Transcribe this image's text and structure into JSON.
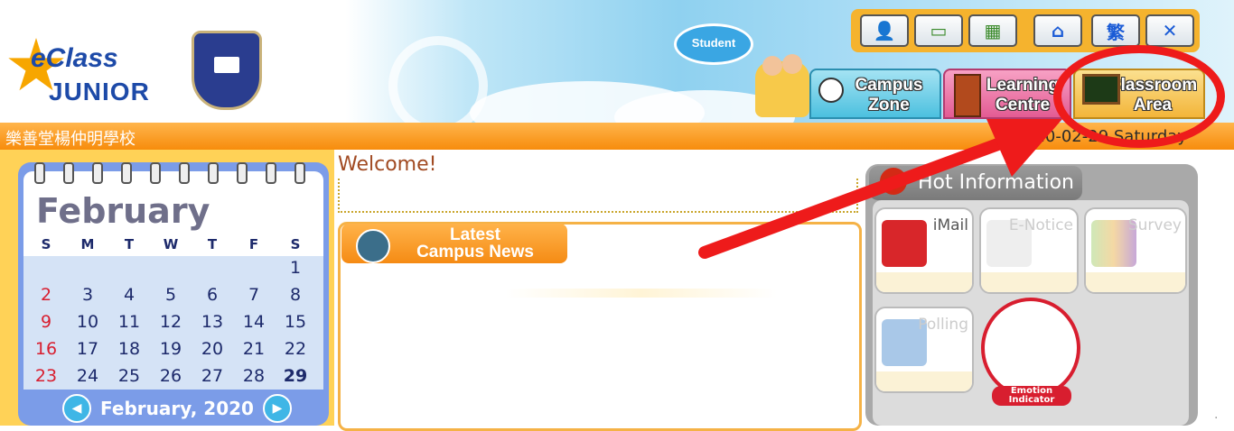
{
  "header": {
    "logo_top": "eClass",
    "logo_bottom": "JUNIOR",
    "badge": "Student"
  },
  "toolbar": {
    "buttons": [
      {
        "name": "user-settings",
        "icon": "person-check-icon",
        "glyph": "👤"
      },
      {
        "name": "profile-card",
        "icon": "id-card-icon",
        "glyph": "▭"
      },
      {
        "name": "calendar",
        "icon": "calendar-icon",
        "glyph": "▦"
      },
      {
        "name": "home",
        "icon": "home-icon",
        "glyph": "⌂"
      },
      {
        "name": "language",
        "icon": "language-icon",
        "glyph": "繁"
      },
      {
        "name": "close",
        "icon": "close-icon",
        "glyph": "✕"
      }
    ]
  },
  "nav": {
    "campus": {
      "line1": "Campus",
      "line2": "Zone"
    },
    "learning": {
      "line1": "Learning",
      "line2": "Centre"
    },
    "classroom": {
      "line1": "Classroom",
      "line2": "Area"
    }
  },
  "bar": {
    "school": "樂善堂楊仲明學校",
    "date": "2020-02-29 Saturday"
  },
  "calendar": {
    "month": "February",
    "weekdays": [
      "S",
      "M",
      "T",
      "W",
      "T",
      "F",
      "S"
    ],
    "weeks": [
      [
        "",
        "",
        "",
        "",
        "",
        "",
        "1"
      ],
      [
        "2",
        "3",
        "4",
        "5",
        "6",
        "7",
        "8"
      ],
      [
        "9",
        "10",
        "11",
        "12",
        "13",
        "14",
        "15"
      ],
      [
        "16",
        "17",
        "18",
        "19",
        "20",
        "21",
        "22"
      ],
      [
        "23",
        "24",
        "25",
        "26",
        "27",
        "28",
        "29"
      ]
    ],
    "today": "29",
    "nav_label": "February, 2020"
  },
  "main": {
    "welcome": "Welcome!",
    "news_title_1": "Latest",
    "news_title_2": "Campus News"
  },
  "hot": {
    "title": "Hot Information",
    "items": [
      {
        "label": "iMail",
        "active": true,
        "icon": "mailbox-icon"
      },
      {
        "label": "E-Notice",
        "active": false,
        "icon": "notice-icon"
      },
      {
        "label": "Survey",
        "active": false,
        "icon": "survey-icon"
      },
      {
        "label": "Polling",
        "active": false,
        "icon": "polling-icon"
      }
    ],
    "emotion_1": "Emotion",
    "emotion_2": "Indicator"
  },
  "colors": {
    "orange_bar": "#f78c0c",
    "calendar_blue": "#7b9ce8",
    "annotation_red": "#ee1b1b"
  }
}
